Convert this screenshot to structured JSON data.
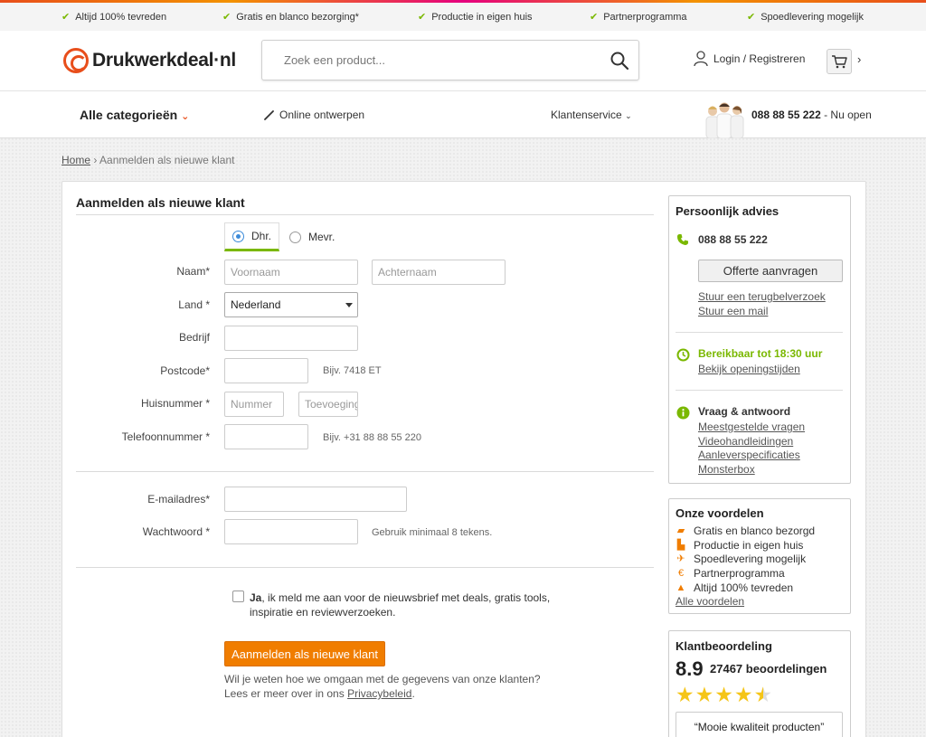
{
  "usp_bar": {
    "items": [
      "Altijd 100% tevreden",
      "Gratis en blanco bezorging*",
      "Productie in eigen huis",
      "Partnerprogramma",
      "Spoedlevering mogelijk"
    ]
  },
  "header": {
    "logo_text": "Drukwerkdeal·nl",
    "search_placeholder": "Zoek een product...",
    "login_label": "Login / Registreren",
    "cart_chevron": "›"
  },
  "nav": {
    "categories_label": "Alle categorieën",
    "design_label": "Online ontwerpen",
    "service_label": "Klantenservice",
    "phone": "088 88 55 222",
    "phone_status": " - Nu open"
  },
  "breadcrumb": {
    "home": "Home",
    "separator": " › ",
    "current": "Aanmelden als nieuwe klant"
  },
  "form": {
    "title": "Aanmelden als nieuwe klant",
    "gender_options": [
      "Dhr.",
      "Mevr."
    ],
    "name_label": "Naam*",
    "first_name_placeholder": "Voornaam",
    "last_name_placeholder": "Achternaam",
    "country_label": "Land *",
    "country_value": "Nederland",
    "company_label": "Bedrijf",
    "postcode_label": "Postcode*",
    "postcode_hint": "Bijv. 7418 ET",
    "house_number_label": "Huisnummer *",
    "house_number_placeholder": "Nummer",
    "addition_placeholder": "Toevoeging",
    "phone_label": "Telefoonnummer *",
    "phone_hint": "Bijv. +31 88 88 55 220",
    "email_label": "E-mailadres*",
    "password_label": "Wachtwoord *",
    "password_hint": "Gebruik minimaal 8 tekens.",
    "newsletter_bold": "Ja",
    "newsletter_text": ", ik meld me aan voor de nieuwsbrief met deals, gratis tools, inspiratie en reviewverzoeken.",
    "submit_label": "Aanmelden als nieuwe klant",
    "privacy_line1": "Wil je weten hoe we omgaan met de gegevens van onze klanten?",
    "privacy_line2_prefix": "Lees er meer over in ons ",
    "privacy_link": "Privacybeleid",
    "privacy_suffix": "."
  },
  "sidebar": {
    "advice": {
      "title": "Persoonlijk advies",
      "phone": "088 88 55 222",
      "quote_button": "Offerte aanvragen",
      "callback_link": "Stuur een terugbelverzoek",
      "mail_link": "Stuur een mail",
      "hours_text": "Bereikbaar tot 18:30 uur",
      "hours_link": "Bekijk openingstijden",
      "faq_title": "Vraag & antwoord",
      "faq_links": [
        "Meestgestelde vragen",
        "Videohandleidingen",
        "Aanleverspecificaties",
        "Monsterbox"
      ]
    },
    "benefits": {
      "title": "Onze voordelen",
      "items": [
        "Gratis en blanco bezorgd",
        "Productie in eigen huis",
        "Spoedlevering mogelijk",
        "Partnerprogramma",
        "Altijd 100% tevreden"
      ],
      "all_link": "Alle voordelen"
    },
    "rating": {
      "title": "Klantbeoordeling",
      "score": "8.9",
      "count": "27467 beoordelingen",
      "stars_value": 4.5,
      "stars_max": 5,
      "review_quote": "“Mooie kwaliteit producten”"
    }
  },
  "colors": {
    "accent_orange": "#f07d00",
    "accent_green": "#7ab800",
    "brand_red": "#e84e1b"
  }
}
